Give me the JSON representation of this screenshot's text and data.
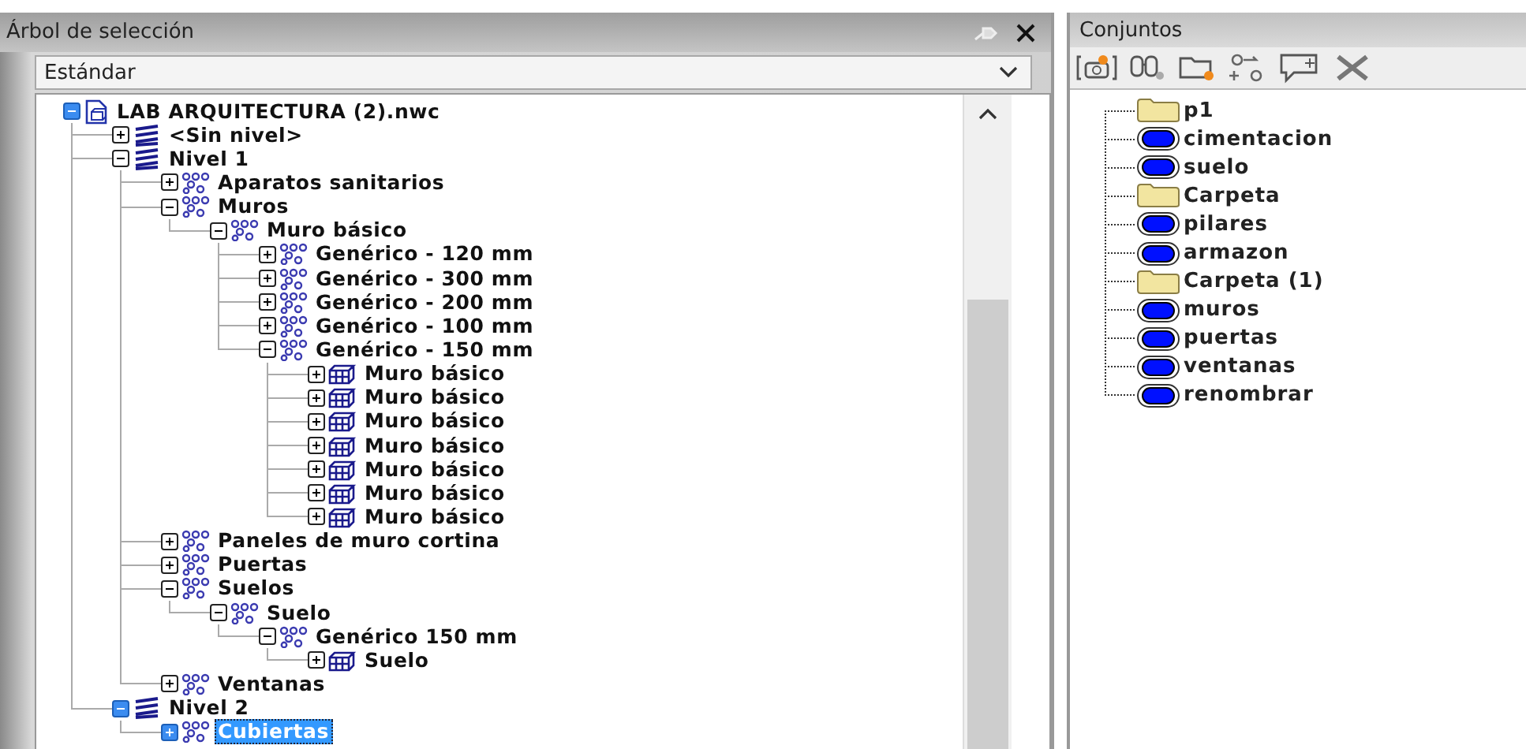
{
  "selection_tree": {
    "title": "Árbol de selección",
    "dropdown": {
      "value": "Estándar"
    },
    "nodes": [
      {
        "label": "LAB ARQUITECTURA (2).nwc",
        "kind": "file",
        "expanded": true,
        "selected": false,
        "children": [
          {
            "label": "<Sin nivel>",
            "kind": "layer",
            "expanded": false,
            "selected": false
          },
          {
            "label": "Nivel 1",
            "kind": "layer",
            "expanded": true,
            "selected": false,
            "children": [
              {
                "label": "Aparatos sanitarios",
                "kind": "group",
                "expanded": false,
                "selected": false
              },
              {
                "label": "Muros",
                "kind": "group",
                "expanded": true,
                "selected": false,
                "children": [
                  {
                    "label": "Muro básico",
                    "kind": "group",
                    "expanded": true,
                    "selected": false,
                    "children": [
                      {
                        "label": "Genérico - 120 mm",
                        "kind": "group",
                        "expanded": false,
                        "selected": false
                      },
                      {
                        "label": "Genérico - 300 mm",
                        "kind": "group",
                        "expanded": false,
                        "selected": false
                      },
                      {
                        "label": "Genérico - 200 mm",
                        "kind": "group",
                        "expanded": false,
                        "selected": false
                      },
                      {
                        "label": "Genérico - 100 mm",
                        "kind": "group",
                        "expanded": false,
                        "selected": false
                      },
                      {
                        "label": "Genérico - 150 mm",
                        "kind": "group",
                        "expanded": true,
                        "selected": false,
                        "children": [
                          {
                            "label": "Muro básico",
                            "kind": "geometry",
                            "expanded": false,
                            "selected": false
                          },
                          {
                            "label": "Muro básico",
                            "kind": "geometry",
                            "expanded": false,
                            "selected": false
                          },
                          {
                            "label": "Muro básico",
                            "kind": "geometry",
                            "expanded": false,
                            "selected": false
                          },
                          {
                            "label": "Muro básico",
                            "kind": "geometry",
                            "expanded": false,
                            "selected": false
                          },
                          {
                            "label": "Muro básico",
                            "kind": "geometry",
                            "expanded": false,
                            "selected": false
                          },
                          {
                            "label": "Muro básico",
                            "kind": "geometry",
                            "expanded": false,
                            "selected": false
                          },
                          {
                            "label": "Muro básico",
                            "kind": "geometry",
                            "expanded": false,
                            "selected": false
                          }
                        ]
                      }
                    ]
                  }
                ]
              },
              {
                "label": "Paneles de muro cortina",
                "kind": "group",
                "expanded": false,
                "selected": false
              },
              {
                "label": "Puertas",
                "kind": "group",
                "expanded": false,
                "selected": false
              },
              {
                "label": "Suelos",
                "kind": "group",
                "expanded": true,
                "selected": false,
                "children": [
                  {
                    "label": "Suelo",
                    "kind": "group",
                    "expanded": true,
                    "selected": false,
                    "children": [
                      {
                        "label": "Genérico 150 mm",
                        "kind": "group",
                        "expanded": true,
                        "selected": false,
                        "children": [
                          {
                            "label": "Suelo",
                            "kind": "geometry",
                            "expanded": false,
                            "selected": false
                          }
                        ]
                      }
                    ]
                  }
                ]
              },
              {
                "label": "Ventanas",
                "kind": "group",
                "expanded": false,
                "selected": false
              }
            ]
          },
          {
            "label": "Nivel 2",
            "kind": "layer",
            "expanded": true,
            "selected": false,
            "children": [
              {
                "label": "Cubiertas",
                "kind": "group",
                "expanded": false,
                "selected": true
              }
            ]
          }
        ]
      }
    ]
  },
  "sets": {
    "title": "Conjuntos",
    "items": [
      {
        "label": "p1",
        "kind": "folder"
      },
      {
        "label": "cimentacion",
        "kind": "set"
      },
      {
        "label": "suelo",
        "kind": "set"
      },
      {
        "label": "Carpeta",
        "kind": "folder"
      },
      {
        "label": "pilares",
        "kind": "set"
      },
      {
        "label": "armazon",
        "kind": "set"
      },
      {
        "label": "Carpeta (1)",
        "kind": "folder"
      },
      {
        "label": "muros",
        "kind": "set"
      },
      {
        "label": "puertas",
        "kind": "set"
      },
      {
        "label": "ventanas",
        "kind": "set"
      },
      {
        "label": "renombrar",
        "kind": "set"
      }
    ]
  }
}
